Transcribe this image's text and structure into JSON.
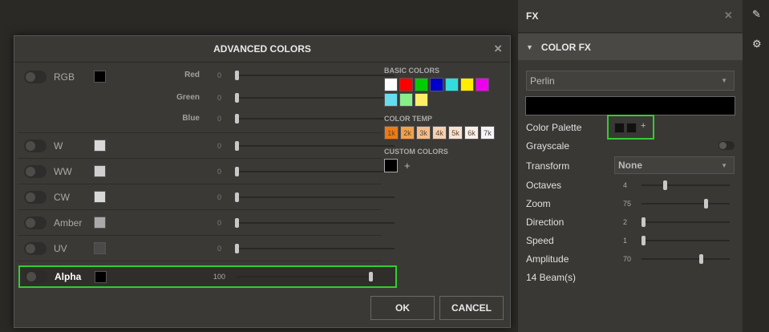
{
  "dialog": {
    "title": "ADVANCED COLORS",
    "close_icon": "×",
    "rgb": {
      "label": "RGB",
      "swatch_color": "#000000",
      "channels": [
        {
          "label": "Red",
          "value": "0",
          "position": 0
        },
        {
          "label": "Green",
          "value": "0",
          "position": 0
        },
        {
          "label": "Blue",
          "value": "0",
          "position": 0
        }
      ]
    },
    "channels": [
      {
        "label": "W",
        "value": "0",
        "swatch_color": "#d9d9d9",
        "position": 0
      },
      {
        "label": "WW",
        "value": "0",
        "swatch_color": "#d0d0d0",
        "position": 0
      },
      {
        "label": "CW",
        "value": "0",
        "swatch_color": "#d8d8d8",
        "position": 0
      },
      {
        "label": "Amber",
        "value": "0",
        "swatch_color": "#aaaaaa",
        "position": 0
      },
      {
        "label": "UV",
        "value": "0",
        "swatch_color": "#4a4a4a",
        "position": 0
      }
    ],
    "alpha": {
      "label": "Alpha",
      "value": "100",
      "swatch_color": "#000000",
      "position": 1
    },
    "basic_colors_title": "BASIC COLORS",
    "basic_colors": [
      "#ffffff",
      "#ff0000",
      "#00cc00",
      "#0000cc",
      "#33dddd",
      "#ffee00",
      "#ee00ee",
      "#66ddee",
      "#88ee88",
      "#ffee66"
    ],
    "color_temp_title": "COLOR TEMP",
    "color_temps": [
      {
        "label": "1k",
        "color": "#f07a10"
      },
      {
        "label": "2k",
        "color": "#f3a048"
      },
      {
        "label": "3k",
        "color": "#f5bd8a"
      },
      {
        "label": "4k",
        "color": "#f6d0b0"
      },
      {
        "label": "5k",
        "color": "#f8e2d0"
      },
      {
        "label": "6k",
        "color": "#faf0e8"
      },
      {
        "label": "7k",
        "color": "#f4f4fa"
      }
    ],
    "custom_colors_title": "CUSTOM COLORS",
    "custom_plus": "+",
    "ok_label": "OK",
    "cancel_label": "CANCEL"
  },
  "fx": {
    "title": "FX",
    "close_icon": "×",
    "section_title": "COLOR FX",
    "effect_select": "Perlin",
    "color_palette_label": "Color Palette",
    "palette_plus": "+",
    "grayscale_label": "Grayscale",
    "transform_label": "Transform",
    "transform_select": "None",
    "params": [
      {
        "label": "Octaves",
        "value": "4",
        "position": 0.25
      },
      {
        "label": "Zoom",
        "value": "75",
        "position": 0.74
      },
      {
        "label": "Direction",
        "value": "2",
        "position": 0.0
      },
      {
        "label": "Speed",
        "value": "1",
        "position": 0.0
      },
      {
        "label": "Amplitude",
        "value": "70",
        "position": 0.68
      }
    ],
    "beams": "14 Beam(s)"
  },
  "sidebar": {
    "edit_icon": "pencil-icon",
    "settings_icon": "gear-icon"
  }
}
